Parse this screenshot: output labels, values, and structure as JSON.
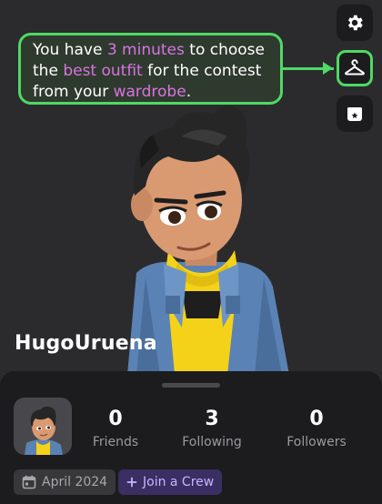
{
  "tooltip": {
    "part1": "You have ",
    "highlight1": "3 minutes",
    "part2": " to choose the ",
    "highlight2": "best outfit",
    "part3": " for the contest from your ",
    "highlight3": "wardrobe",
    "part4": "."
  },
  "side_buttons": [
    {
      "icon": "gear-icon"
    },
    {
      "icon": "hanger-icon"
    },
    {
      "icon": "store-icon"
    }
  ],
  "profile": {
    "username": "HugoUruena",
    "stats": {
      "friends": {
        "value": "0",
        "label": "Friends"
      },
      "following": {
        "value": "3",
        "label": "Following"
      },
      "followers": {
        "value": "0",
        "label": "Followers"
      }
    },
    "joined": "April 2024",
    "crew_button": "Join a Crew"
  },
  "colors": {
    "highlight": "#d873e0",
    "accent_green": "#4fd964",
    "crew_purple": "#3a2e63"
  }
}
